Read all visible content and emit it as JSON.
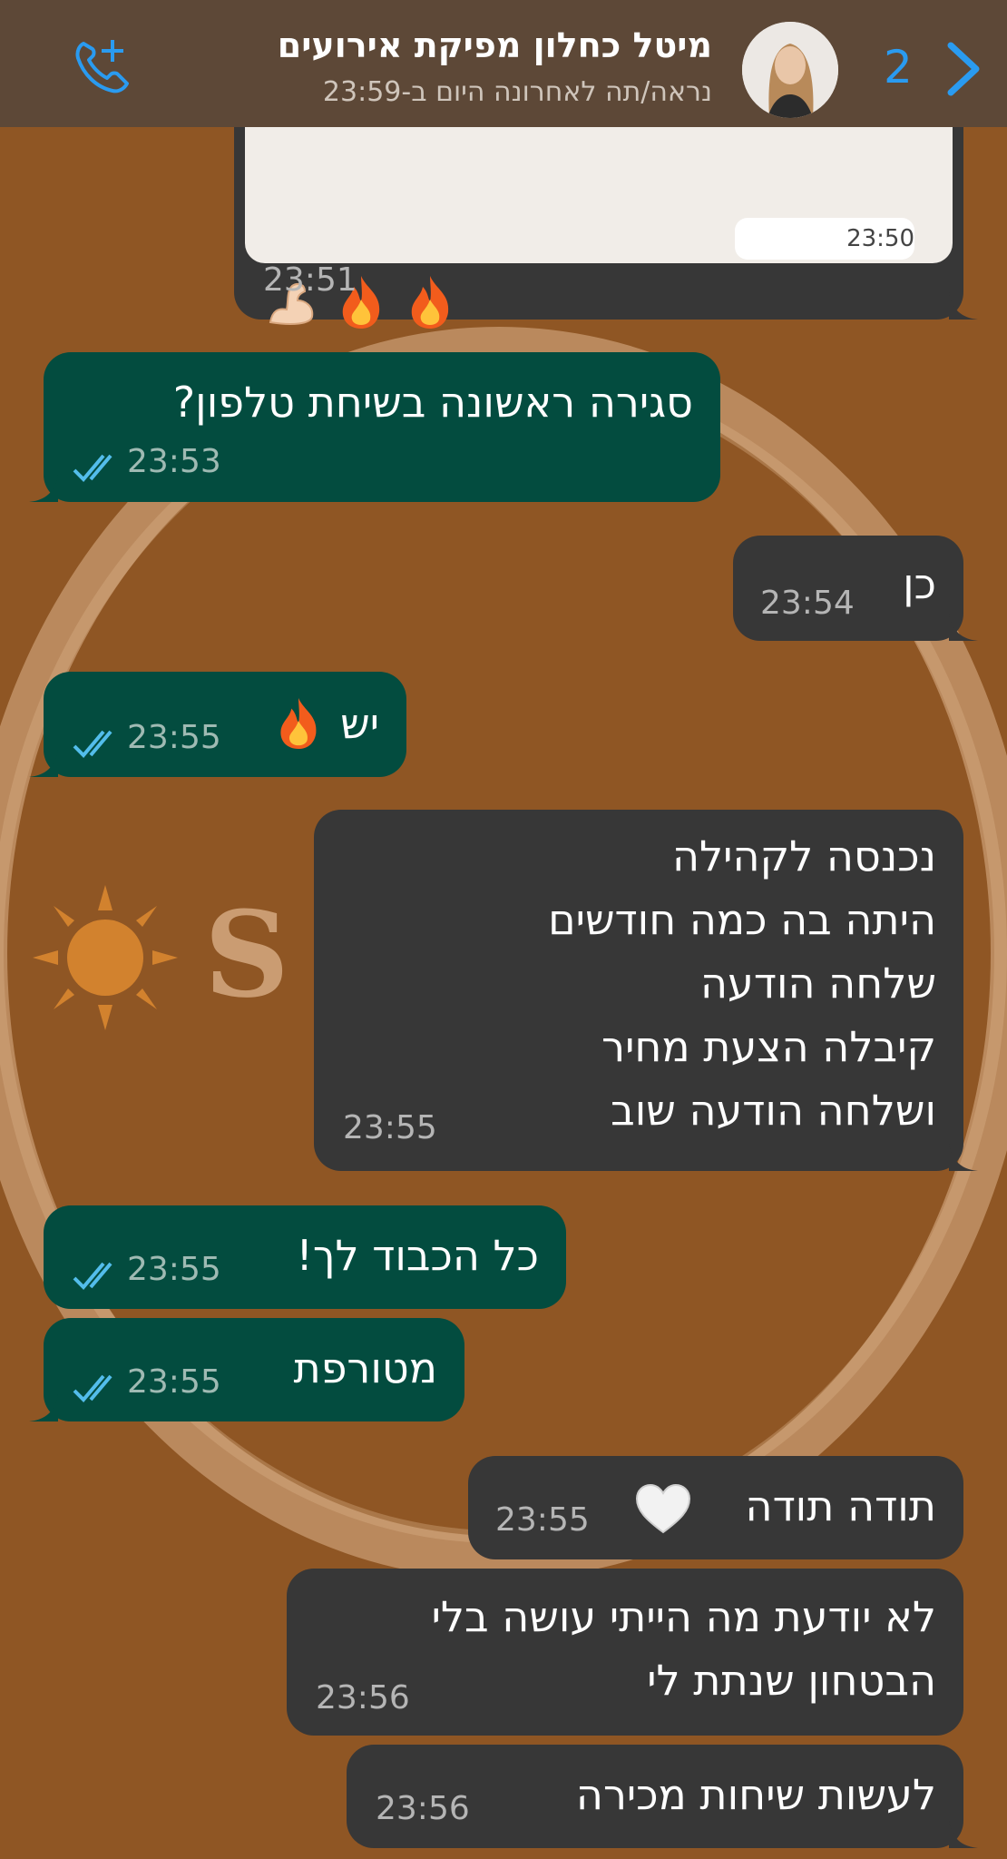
{
  "header": {
    "contact_name": "מיטל כחלון מפיקת אירועים",
    "last_seen": "נראה/תה לאחרונה היום ב-23:59",
    "unread_count": "2",
    "call_icon": "add-call-icon",
    "back_icon": "chevron-right-icon"
  },
  "colors": {
    "wallpaper": "#8f5624",
    "incoming_bubble": "#373737",
    "outgoing_bubble": "#034c3f",
    "accent": "#2a9bf0"
  },
  "messages": [
    {
      "direction": "in",
      "text": "💪🔥🔥",
      "time": "23:51",
      "media_time": "23:50"
    },
    {
      "direction": "out",
      "text": "סגירה ראשונה בשיחת טלפון?",
      "time": "23:53",
      "read": true
    },
    {
      "direction": "in",
      "text": "כן",
      "time": "23:54"
    },
    {
      "direction": "out",
      "text": "יש",
      "emoji": "fire",
      "time": "23:55",
      "read": true
    },
    {
      "direction": "in",
      "lines": [
        "נכנסה לקהילה",
        "היתה בה כמה חודשים",
        "שלחה הודעה",
        "קיבלה הצעת מחיר",
        "ושלחה הודעה שוב"
      ],
      "time": "23:55"
    },
    {
      "direction": "out",
      "text": "כל הכבוד לך!",
      "time": "23:55",
      "read": true
    },
    {
      "direction": "out",
      "text": "מטורפת",
      "time": "23:55",
      "read": true
    },
    {
      "direction": "in",
      "text": "תודה תודה",
      "emoji": "white-heart",
      "time": "23:55"
    },
    {
      "direction": "in",
      "lines": [
        "לא יודעת מה הייתי עושה בלי",
        "הבטחון שנתת לי"
      ],
      "time": "23:56"
    },
    {
      "direction": "in",
      "text": "לעשות שיחות מכירה",
      "time": "23:56"
    }
  ]
}
